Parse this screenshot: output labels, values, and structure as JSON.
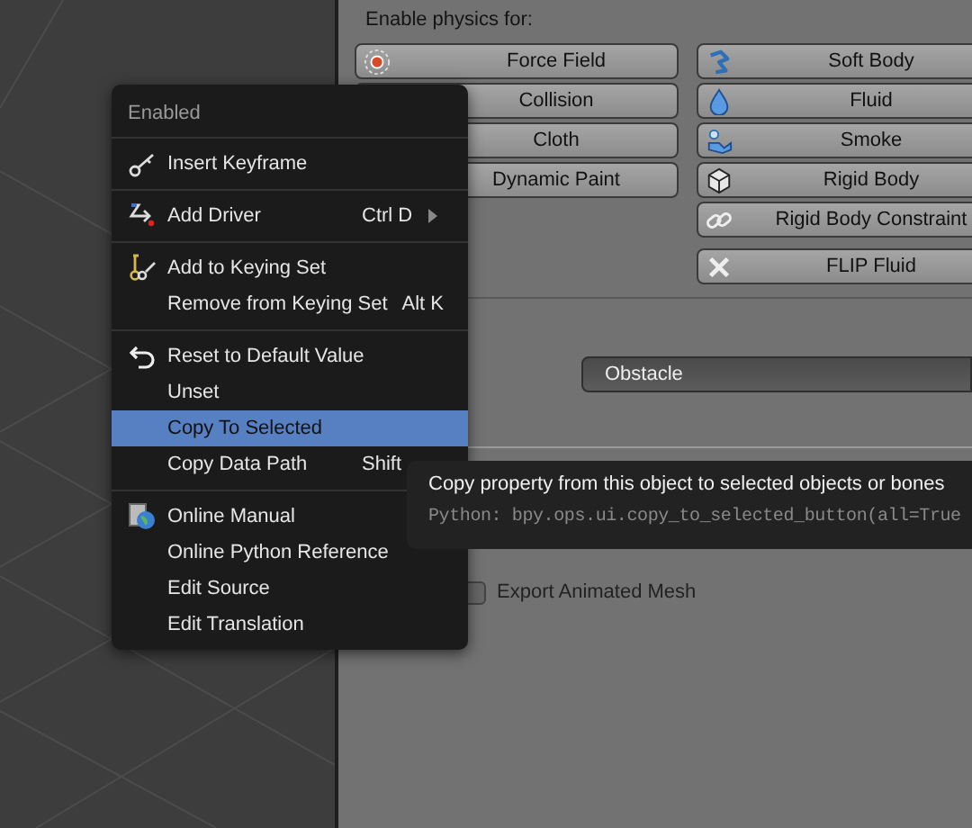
{
  "panel": {
    "heading": "Enable physics for:",
    "left_buttons": [
      {
        "label": "Force Field"
      },
      {
        "label": "Collision"
      },
      {
        "label": "Cloth"
      },
      {
        "label": "Dynamic Paint"
      }
    ],
    "right_buttons": [
      {
        "label": "Soft Body"
      },
      {
        "label": "Fluid"
      },
      {
        "label": "Smoke"
      },
      {
        "label": "Rigid Body"
      },
      {
        "label": "Rigid Body Constraint"
      },
      {
        "label": "FLIP Fluid"
      }
    ],
    "type_value": "Obstacle",
    "export_checkbox": {
      "label": "Export Animated Mesh",
      "checked": false
    }
  },
  "menu": {
    "header": "Enabled",
    "groups": [
      [
        {
          "label": "Insert Keyframe",
          "selected": false
        }
      ],
      [
        {
          "label": "Add Driver",
          "shortcut": "Ctrl D",
          "submenu": true,
          "selected": false
        }
      ],
      [
        {
          "label": "Add to Keying Set",
          "selected": false
        },
        {
          "label": "Remove from Keying Set",
          "shortcut": "Alt K",
          "selected": false
        }
      ],
      [
        {
          "label": "Reset to Default Value",
          "selected": false
        },
        {
          "label": "Unset",
          "selected": false
        },
        {
          "label": "Copy To Selected",
          "selected": true
        },
        {
          "label": "Copy Data Path",
          "shortcut": "Shift",
          "selected": false
        }
      ],
      [
        {
          "label": "Online Manual",
          "selected": false
        },
        {
          "label": "Online Python Reference",
          "selected": false
        },
        {
          "label": "Edit Source",
          "selected": false
        },
        {
          "label": "Edit Translation",
          "selected": false
        }
      ]
    ]
  },
  "tooltip": {
    "title": "Copy property from this object to selected objects or bones",
    "python": "Python: bpy.ops.ui.copy_to_selected_button(all=True"
  }
}
